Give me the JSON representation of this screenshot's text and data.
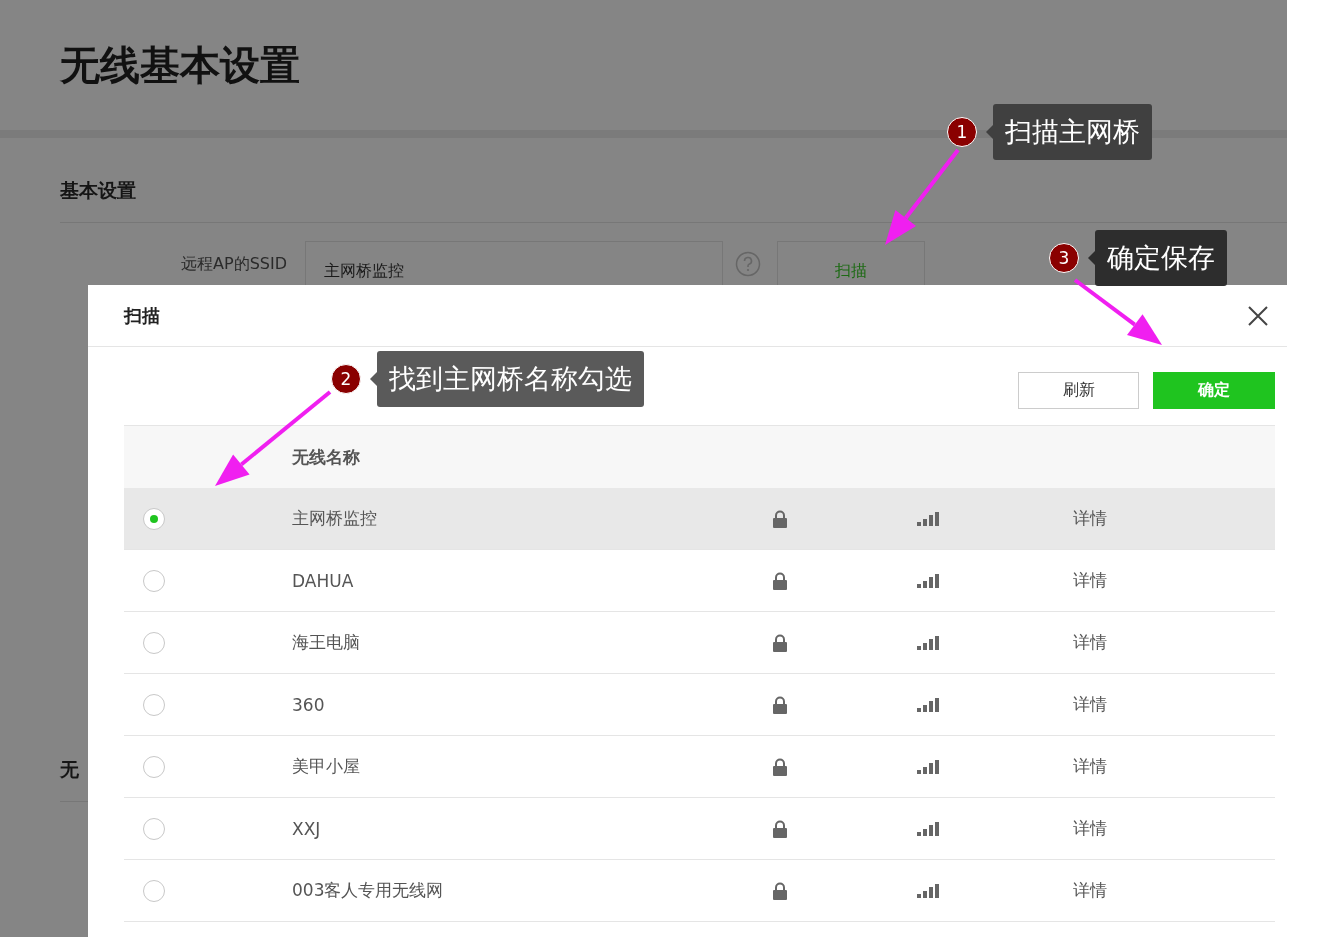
{
  "page": {
    "title": "无线基本设置",
    "section": "基本设置",
    "ssid_label": "远程AP的SSID",
    "ssid_value": "主网桥监控",
    "scan_button": "扫描",
    "section_2": "无"
  },
  "dialog": {
    "title": "扫描",
    "buttons": [
      {
        "label": "刷新",
        "kind": "secondary"
      },
      {
        "label": "确定",
        "kind": "primary"
      }
    ],
    "column": "无线名称",
    "rows": [
      {
        "name": "主网桥监控",
        "selected": true,
        "detail": "详情"
      },
      {
        "name": "DAHUA",
        "selected": false,
        "detail": "详情"
      },
      {
        "name": "海王电脑",
        "selected": false,
        "detail": "详情"
      },
      {
        "name": "360",
        "selected": false,
        "detail": "详情"
      },
      {
        "name": "美甲小屋",
        "selected": false,
        "detail": "详情"
      },
      {
        "name": "XXJ",
        "selected": false,
        "detail": "详情"
      },
      {
        "name": "003客人专用无线网",
        "selected": false,
        "detail": "详情"
      }
    ]
  },
  "annotations": [
    {
      "number": "1",
      "text": "扫描主网桥"
    },
    {
      "number": "2",
      "text": "找到主网桥名称勾选"
    },
    {
      "number": "3",
      "text": "确定保存"
    }
  ]
}
